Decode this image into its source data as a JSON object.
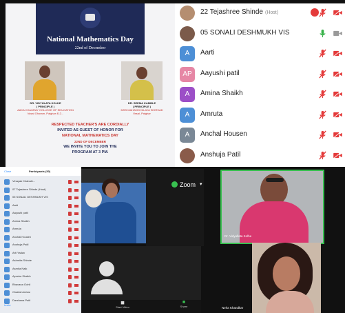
{
  "invite": {
    "title": "National Mathematics Day",
    "date": "22nd of December",
    "guest_left": {
      "name": "DR. VIDYULATA KOLHE",
      "role": "( PRINCIPLE )",
      "line1": "AAKA CHAURAY COLLEGE OF EDUCATION",
      "line2": "Vasai Ghoram, Palghar 412..."
    },
    "guest_right": {
      "name": "DR. SEEMA KAMBLE",
      "role": "( PRINCIPLE )",
      "line1": "MSS MAHAVIDYALAYA SHIRSAD",
      "line2": "Vasai, Palghar"
    },
    "line_respected": "RESPECTED TEACHER'S ARE CORDIALLY",
    "line_invited": "INVITED AS GUEST OF HONOR FOR",
    "line_event": "NATIONAL MATHEMATICS DAY",
    "line_date": "22ND OF DECEMBER",
    "line_invite": "WE INVITE YOU TO JOIN THE",
    "line_time": "PROGRAM AT 3 PM."
  },
  "participants": [
    {
      "name": "22 Tejashree Shinde",
      "tag": "(Host)",
      "avatar": "photo",
      "color": "#b58e70",
      "mic": "muted",
      "video": "off"
    },
    {
      "name": "05 SONALI DESHMUKH VIS",
      "tag": "",
      "avatar": "photo",
      "color": "#7b5a4a",
      "mic": "on",
      "video": "on"
    },
    {
      "name": "Aarti",
      "tag": "",
      "avatar": "A",
      "color": "#4d8fd6",
      "mic": "muted",
      "video": "off"
    },
    {
      "name": "Aayushi patil",
      "tag": "",
      "avatar": "AP",
      "color": "#e687a5",
      "mic": "muted",
      "video": "off"
    },
    {
      "name": "Amina Shaikh",
      "tag": "",
      "avatar": "A",
      "color": "#9c4fc7",
      "mic": "muted",
      "video": "off"
    },
    {
      "name": "Amruta",
      "tag": "",
      "avatar": "A",
      "color": "#4d8fd6",
      "mic": "muted",
      "video": "off"
    },
    {
      "name": "Anchal Housen",
      "tag": "",
      "avatar": "A",
      "color": "#7a8896",
      "mic": "muted",
      "video": "off"
    },
    {
      "name": "Anshuja Patil",
      "tag": "",
      "avatar": "photo",
      "color": "#8a5b4a",
      "mic": "muted",
      "video": "off"
    }
  ],
  "mini_panel": {
    "header_left": "Close",
    "header_title": "Participants (50)",
    "rows": [
      "Vinayak Khabale...",
      "07 Tejashree Shinde (Host)",
      "05 SONALI DESHMUKH VIS",
      "Aarti",
      "Aayushi patil",
      "Amina Shaikh",
      "Amruta",
      "Anchal Housen",
      "Anshuja Patil",
      "Arti Yadav",
      "Ashmita Shinde",
      "Asmita Naik",
      "Ayesha Shaikh",
      "Bhavana Gohil",
      "Chaitali Arekar",
      "Darshana Patil"
    ],
    "footer": "Invite"
  },
  "zoom_label": "Zoom",
  "tiles": {
    "lady_name": "Dr. Vidyullata Kolhe",
    "neha_name": "Neha Khandkar"
  },
  "controls": {
    "start_video": "Start Video",
    "share": "Share"
  },
  "icons": {
    "mic_muted": "mic-muted-icon",
    "video_off": "video-off-icon",
    "mic_on": "mic-icon",
    "video_on": "video-icon"
  }
}
